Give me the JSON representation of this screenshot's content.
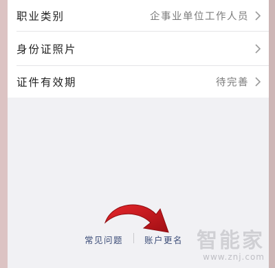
{
  "rows": [
    {
      "label": "职业类别",
      "value": "企事业单位工作人员"
    },
    {
      "label": "身份证照片",
      "value": ""
    },
    {
      "label": "证件有效期",
      "value": "待完善"
    }
  ],
  "footer": {
    "faq": "常见问题",
    "rename": "账户更名"
  },
  "watermark": {
    "text": "智能家",
    "url": "www.znj.com"
  },
  "icons": {
    "chevron": "chevron-right-icon",
    "arrow": "curved-arrow-icon"
  },
  "colors": {
    "link": "#3c4d78",
    "arrow": "#c8161b",
    "background": "#f1f1f4"
  }
}
